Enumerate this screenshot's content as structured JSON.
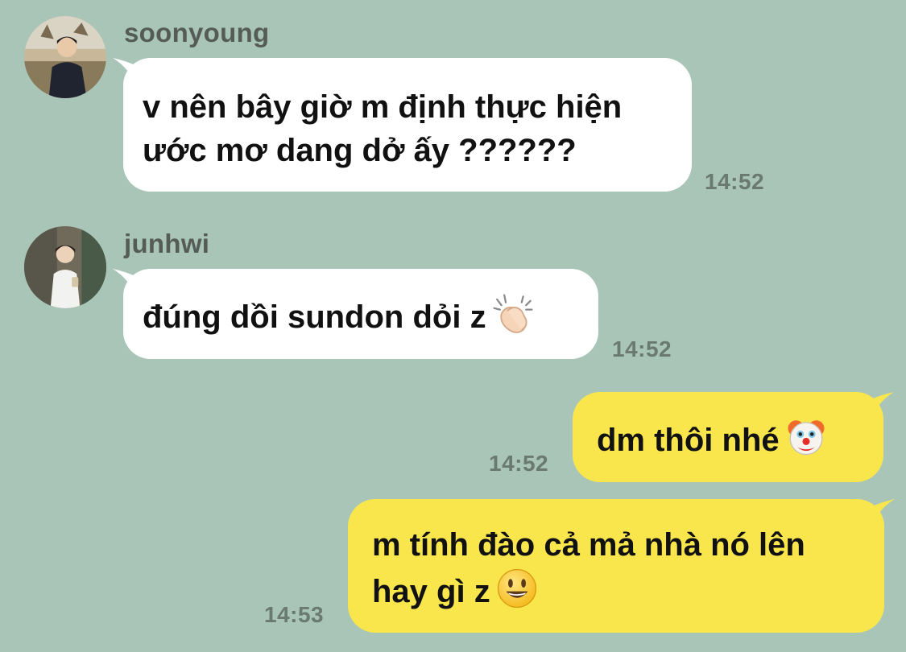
{
  "messages": [
    {
      "sender": "soonyoung",
      "lines": [
        "v nên bây giờ m định thực hiện",
        "ước mơ dang dở ấy ??????"
      ],
      "time": "14:52",
      "direction": "incoming"
    },
    {
      "sender": "junhwi",
      "lines": [
        "đúng dồi sundon dỏi z"
      ],
      "emoji": "clapping-hands-emoji",
      "time": "14:52",
      "direction": "incoming"
    },
    {
      "lines": [
        "dm thôi nhé"
      ],
      "emoji": "clown-face-emoji",
      "time": "14:52",
      "direction": "outgoing"
    },
    {
      "lines": [
        "m tính đào cả mả nhà nó lên",
        "hay gì z"
      ],
      "emoji": "smiling-face-emoji",
      "time": "14:53",
      "direction": "outgoing"
    }
  ],
  "colors": {
    "background": "#a8c5b7",
    "incoming_bubble": "#ffffff",
    "outgoing_bubble": "#f9e64d",
    "timestamp": "#6a7a72",
    "sender_name": "#555c58"
  }
}
